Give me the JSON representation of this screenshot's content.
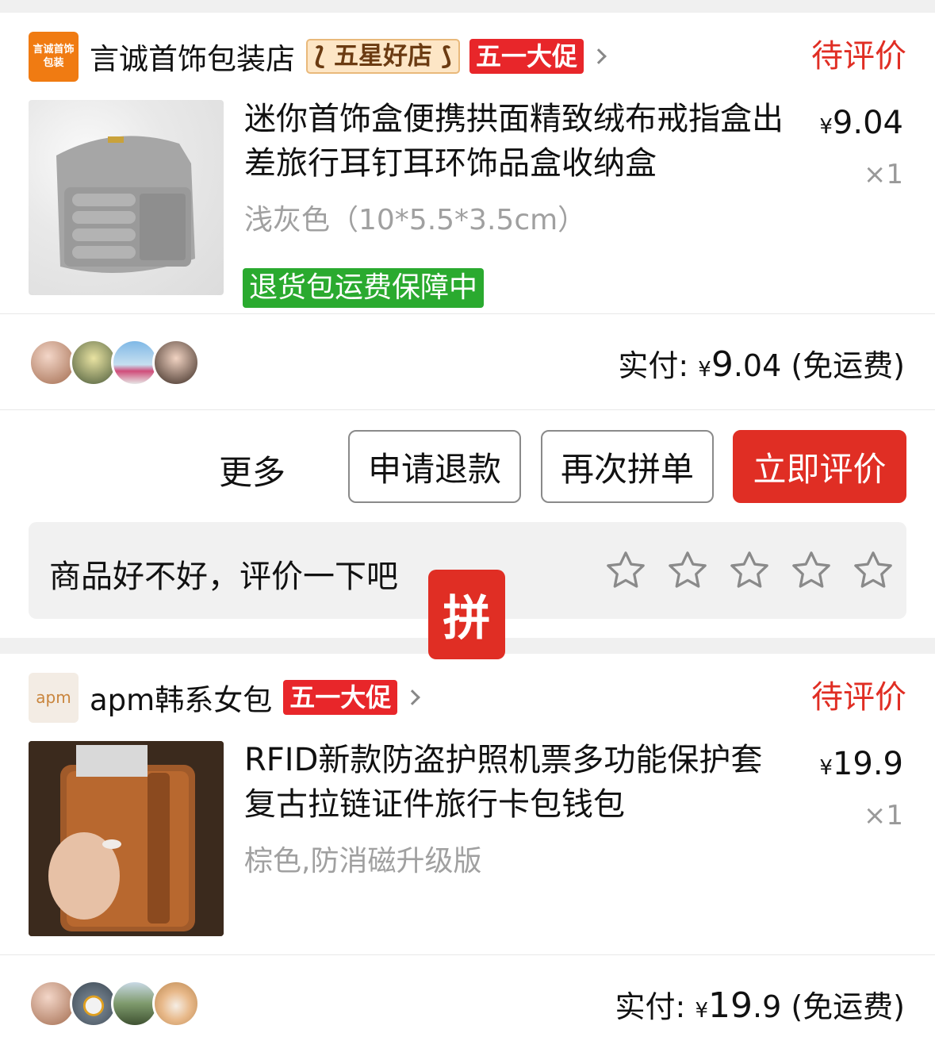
{
  "orders": [
    {
      "shop": {
        "logo_text": "言诚首饰包装",
        "name": "言诚首饰包装店",
        "badge_star": "五星好店",
        "badge_promo": "五一大促"
      },
      "status": "待评价",
      "product": {
        "title": "迷你首饰盒便携拱面精致绒布戒指盒出差旅行耳钉耳环饰品盒收纳盒",
        "spec": "浅灰色（10*5.5*3.5cm）",
        "guarantee": "退货包运费保障中",
        "price_symbol": "¥",
        "price_int": "9",
        "price_dec": ".04",
        "quantity": "×1"
      },
      "payment": {
        "label": "实付:",
        "symbol": "¥",
        "amount_int": "9",
        "amount_dec": ".04",
        "shipping": "(免运费)"
      },
      "actions": {
        "more": "更多",
        "refund": "申请退款",
        "reorder": "再次拼单",
        "review": "立即评价"
      },
      "rating": {
        "prompt": "商品好不好，评价一下吧",
        "stars": 5
      }
    },
    {
      "shop": {
        "logo_text": "apm",
        "name": "apm韩系女包",
        "badge_promo": "五一大促"
      },
      "status": "待评价",
      "product": {
        "title": "RFID新款防盗护照机票多功能保护套 复古拉链证件旅行卡包钱包",
        "spec": "棕色,防消磁升级版",
        "price_symbol": "¥",
        "price_int": "19",
        "price_dec": ".9",
        "quantity": "×1"
      },
      "payment": {
        "label": "实付:",
        "symbol": "¥",
        "amount_int": "19",
        "amount_dec": ".9",
        "shipping": "(免运费)"
      }
    }
  ],
  "floating_badge": "拼",
  "colors": {
    "accent_red": "#e02e24",
    "guarantee_green": "#2aaa2f",
    "shop_logo_orange": "#f07b12"
  }
}
